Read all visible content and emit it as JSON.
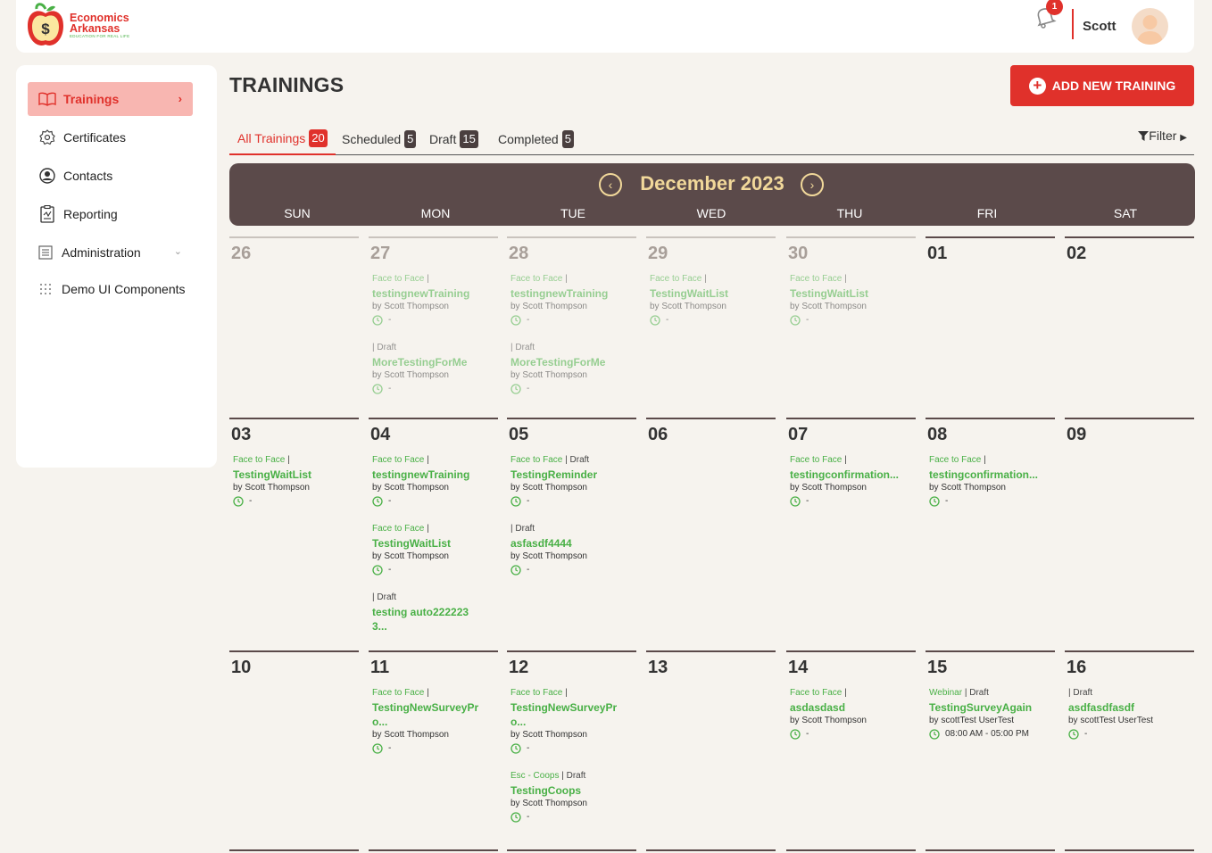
{
  "header": {
    "logo_line1": "Economics",
    "logo_line2": "Arkansas",
    "logo_tagline": "EDUCATION FOR REAL LIFE",
    "notification_count": "1",
    "user_name": "Scott"
  },
  "sidebar": {
    "items": [
      {
        "label": "Trainings"
      },
      {
        "label": "Certificates"
      },
      {
        "label": "Contacts"
      },
      {
        "label": "Reporting"
      },
      {
        "label": "Administration"
      },
      {
        "label": "Demo UI Components"
      }
    ]
  },
  "main": {
    "title": "TRAININGS",
    "add_button": "ADD NEW TRAINING",
    "tabs": [
      {
        "label": "All Trainings",
        "count": "20"
      },
      {
        "label": "Scheduled",
        "count": "5"
      },
      {
        "label": "Draft",
        "count": "15"
      },
      {
        "label": "Completed",
        "count": "5"
      }
    ],
    "filter_label": "Filter"
  },
  "calendar": {
    "month": "December 2023",
    "days_of_week": [
      "SUN",
      "MON",
      "TUE",
      "WED",
      "THU",
      "FRI",
      "SAT"
    ],
    "weeks": [
      [
        {
          "num": "26",
          "past": true,
          "events": []
        },
        {
          "num": "27",
          "past": true,
          "events": [
            {
              "type": "Face to Face",
              "status": "",
              "title": "testingnewTraining",
              "by": "by Scott Thompson",
              "time": "-"
            },
            {
              "type": "",
              "status": "Draft",
              "title": "MoreTestingForMe",
              "by": "by Scott Thompson",
              "time": "-"
            }
          ]
        },
        {
          "num": "28",
          "past": true,
          "events": [
            {
              "type": "Face to Face",
              "status": "",
              "title": "testingnewTraining",
              "by": "by Scott Thompson",
              "time": "-"
            },
            {
              "type": "",
              "status": "Draft",
              "title": "MoreTestingForMe",
              "by": "by Scott Thompson",
              "time": "-"
            }
          ]
        },
        {
          "num": "29",
          "past": true,
          "events": [
            {
              "type": "Face to Face",
              "status": "",
              "title": "TestingWaitList",
              "by": "by Scott Thompson",
              "time": "-"
            }
          ]
        },
        {
          "num": "30",
          "past": true,
          "events": [
            {
              "type": "Face to Face",
              "status": "",
              "title": "TestingWaitList",
              "by": "by Scott Thompson",
              "time": "-"
            }
          ]
        },
        {
          "num": "01",
          "past": false,
          "events": []
        },
        {
          "num": "02",
          "past": false,
          "events": []
        }
      ],
      [
        {
          "num": "03",
          "past": false,
          "events": [
            {
              "type": "Face to Face",
              "status": "",
              "title": "TestingWaitList",
              "by": "by Scott Thompson",
              "time": "-"
            }
          ]
        },
        {
          "num": "04",
          "past": false,
          "events": [
            {
              "type": "Face to Face",
              "status": "",
              "title": "testingnewTraining",
              "by": "by Scott Thompson",
              "time": "-"
            },
            {
              "type": "Face to Face",
              "status": "",
              "title": "TestingWaitList",
              "by": "by Scott Thompson",
              "time": "-"
            },
            {
              "type": "",
              "status": "Draft",
              "title": "testing auto222223 3...",
              "by": "",
              "time": ""
            }
          ]
        },
        {
          "num": "05",
          "past": false,
          "events": [
            {
              "type": "Face to Face",
              "status": "Draft",
              "title": "TestingReminder",
              "by": "by Scott Thompson",
              "time": "-"
            },
            {
              "type": "",
              "status": "Draft",
              "title": "asfasdf4444",
              "by": "by Scott Thompson",
              "time": "-"
            }
          ]
        },
        {
          "num": "06",
          "past": false,
          "events": []
        },
        {
          "num": "07",
          "past": false,
          "events": [
            {
              "type": "Face to Face",
              "status": "",
              "title": "testingconfirmation...",
              "by": "by Scott Thompson",
              "time": "-"
            }
          ]
        },
        {
          "num": "08",
          "past": false,
          "events": [
            {
              "type": "Face to Face",
              "status": "",
              "title": "testingconfirmation...",
              "by": "by Scott Thompson",
              "time": "-"
            }
          ]
        },
        {
          "num": "09",
          "past": false,
          "events": []
        }
      ],
      [
        {
          "num": "10",
          "past": false,
          "events": []
        },
        {
          "num": "11",
          "past": false,
          "events": [
            {
              "type": "Face to Face",
              "status": "",
              "title": "TestingNewSurveyPr o...",
              "by": "by Scott Thompson",
              "time": "-"
            }
          ]
        },
        {
          "num": "12",
          "past": false,
          "events": [
            {
              "type": "Face to Face",
              "status": "",
              "title": "TestingNewSurveyPr o...",
              "by": "by Scott Thompson",
              "time": "-"
            },
            {
              "type": "Esc - Coops",
              "status": "Draft",
              "title": "TestingCoops",
              "by": "by Scott Thompson",
              "time": "-"
            }
          ]
        },
        {
          "num": "13",
          "past": false,
          "events": []
        },
        {
          "num": "14",
          "past": false,
          "events": [
            {
              "type": "Face to Face",
              "status": "",
              "title": "asdasdasd",
              "by": "by Scott Thompson",
              "time": "-"
            }
          ]
        },
        {
          "num": "15",
          "past": false,
          "events": [
            {
              "type": "Webinar",
              "status": "Draft",
              "title": "TestingSurveyAgain",
              "by": "by scottTest UserTest",
              "time": "08:00 AM - 05:00 PM"
            }
          ]
        },
        {
          "num": "16",
          "past": false,
          "events": [
            {
              "type": "",
              "status": "Draft",
              "title": "asdfasdfasdf",
              "by": "by scottTest UserTest",
              "time": "-"
            }
          ]
        }
      ]
    ]
  },
  "colors": {
    "brand_red": "#e0312b",
    "event_green": "#49b046",
    "calendar_header": "#5b4a4a",
    "month_gold": "#f1d89a"
  }
}
